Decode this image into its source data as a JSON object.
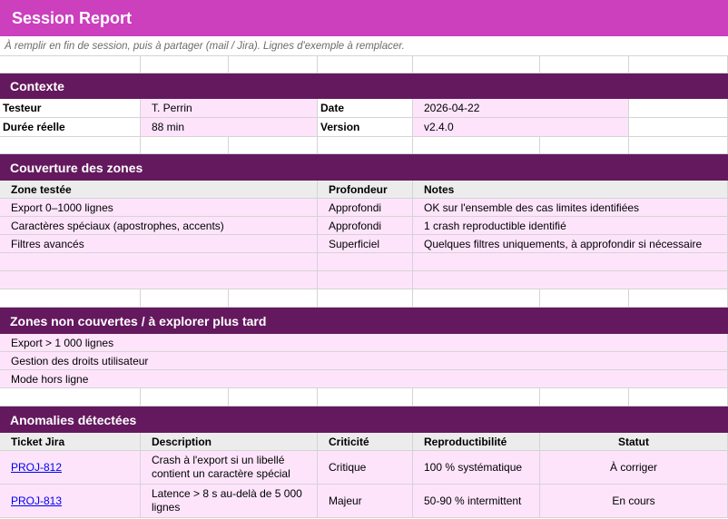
{
  "title": "Session Report",
  "subtitle": "À remplir en fin de session, puis à partager (mail / Jira). Lignes d'exemple à remplacer.",
  "context": {
    "section_title": "Contexte",
    "tester_label": "Testeur",
    "tester_value": "T. Perrin",
    "date_label": "Date",
    "date_value": "2026-04-22",
    "duration_label": "Durée réelle",
    "duration_value": "88 min",
    "version_label": "Version",
    "version_value": "v2.4.0"
  },
  "coverage": {
    "section_title": "Couverture des zones",
    "headers": [
      "Zone testée",
      "Profondeur",
      "Notes"
    ],
    "rows": [
      [
        "Export 0–1000 lignes",
        "Approfondi",
        "OK sur l'ensemble des cas limites identifiées"
      ],
      [
        "Caractères spéciaux (apostrophes, accents)",
        "Approfondi",
        "1 crash reproductible identifié"
      ],
      [
        "Filtres avancés",
        "Superficiel",
        "Quelques filtres uniquements, à approfondir si nécessaire"
      ]
    ]
  },
  "uncovered": {
    "section_title": "Zones non couvertes / à explorer plus tard",
    "items": [
      "Export > 1 000 lignes",
      "Gestion des droits utilisateur",
      "Mode hors ligne"
    ]
  },
  "anomalies": {
    "section_title": "Anomalies détectées",
    "headers": [
      "Ticket Jira",
      "Description",
      "Criticité",
      "Reproductibilité",
      "Statut"
    ],
    "rows": [
      [
        "PROJ-812",
        "Crash à l'export si un libellé contient un caractère spécial",
        "Critique",
        "100 % systématique",
        "À corriger"
      ],
      [
        "PROJ-813",
        "Latence > 8 s au-delà de 5 000 lignes",
        "Majeur",
        "50-90 % intermittent",
        "En cours"
      ]
    ]
  }
}
